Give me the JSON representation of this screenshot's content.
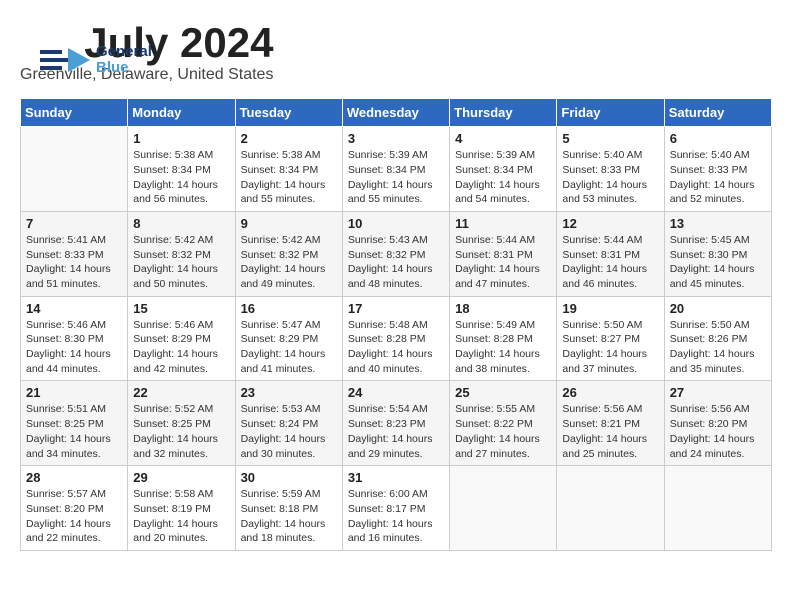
{
  "logo": {
    "part1": "General",
    "part2": "Blue"
  },
  "header": {
    "month": "July 2024",
    "location": "Greenville, Delaware, United States"
  },
  "weekdays": [
    "Sunday",
    "Monday",
    "Tuesday",
    "Wednesday",
    "Thursday",
    "Friday",
    "Saturday"
  ],
  "weeks": [
    [
      {
        "date": "",
        "info": ""
      },
      {
        "date": "1",
        "info": "Sunrise: 5:38 AM\nSunset: 8:34 PM\nDaylight: 14 hours\nand 56 minutes."
      },
      {
        "date": "2",
        "info": "Sunrise: 5:38 AM\nSunset: 8:34 PM\nDaylight: 14 hours\nand 55 minutes."
      },
      {
        "date": "3",
        "info": "Sunrise: 5:39 AM\nSunset: 8:34 PM\nDaylight: 14 hours\nand 55 minutes."
      },
      {
        "date": "4",
        "info": "Sunrise: 5:39 AM\nSunset: 8:34 PM\nDaylight: 14 hours\nand 54 minutes."
      },
      {
        "date": "5",
        "info": "Sunrise: 5:40 AM\nSunset: 8:33 PM\nDaylight: 14 hours\nand 53 minutes."
      },
      {
        "date": "6",
        "info": "Sunrise: 5:40 AM\nSunset: 8:33 PM\nDaylight: 14 hours\nand 52 minutes."
      }
    ],
    [
      {
        "date": "7",
        "info": "Sunrise: 5:41 AM\nSunset: 8:33 PM\nDaylight: 14 hours\nand 51 minutes."
      },
      {
        "date": "8",
        "info": "Sunrise: 5:42 AM\nSunset: 8:32 PM\nDaylight: 14 hours\nand 50 minutes."
      },
      {
        "date": "9",
        "info": "Sunrise: 5:42 AM\nSunset: 8:32 PM\nDaylight: 14 hours\nand 49 minutes."
      },
      {
        "date": "10",
        "info": "Sunrise: 5:43 AM\nSunset: 8:32 PM\nDaylight: 14 hours\nand 48 minutes."
      },
      {
        "date": "11",
        "info": "Sunrise: 5:44 AM\nSunset: 8:31 PM\nDaylight: 14 hours\nand 47 minutes."
      },
      {
        "date": "12",
        "info": "Sunrise: 5:44 AM\nSunset: 8:31 PM\nDaylight: 14 hours\nand 46 minutes."
      },
      {
        "date": "13",
        "info": "Sunrise: 5:45 AM\nSunset: 8:30 PM\nDaylight: 14 hours\nand 45 minutes."
      }
    ],
    [
      {
        "date": "14",
        "info": "Sunrise: 5:46 AM\nSunset: 8:30 PM\nDaylight: 14 hours\nand 44 minutes."
      },
      {
        "date": "15",
        "info": "Sunrise: 5:46 AM\nSunset: 8:29 PM\nDaylight: 14 hours\nand 42 minutes."
      },
      {
        "date": "16",
        "info": "Sunrise: 5:47 AM\nSunset: 8:29 PM\nDaylight: 14 hours\nand 41 minutes."
      },
      {
        "date": "17",
        "info": "Sunrise: 5:48 AM\nSunset: 8:28 PM\nDaylight: 14 hours\nand 40 minutes."
      },
      {
        "date": "18",
        "info": "Sunrise: 5:49 AM\nSunset: 8:28 PM\nDaylight: 14 hours\nand 38 minutes."
      },
      {
        "date": "19",
        "info": "Sunrise: 5:50 AM\nSunset: 8:27 PM\nDaylight: 14 hours\nand 37 minutes."
      },
      {
        "date": "20",
        "info": "Sunrise: 5:50 AM\nSunset: 8:26 PM\nDaylight: 14 hours\nand 35 minutes."
      }
    ],
    [
      {
        "date": "21",
        "info": "Sunrise: 5:51 AM\nSunset: 8:25 PM\nDaylight: 14 hours\nand 34 minutes."
      },
      {
        "date": "22",
        "info": "Sunrise: 5:52 AM\nSunset: 8:25 PM\nDaylight: 14 hours\nand 32 minutes."
      },
      {
        "date": "23",
        "info": "Sunrise: 5:53 AM\nSunset: 8:24 PM\nDaylight: 14 hours\nand 30 minutes."
      },
      {
        "date": "24",
        "info": "Sunrise: 5:54 AM\nSunset: 8:23 PM\nDaylight: 14 hours\nand 29 minutes."
      },
      {
        "date": "25",
        "info": "Sunrise: 5:55 AM\nSunset: 8:22 PM\nDaylight: 14 hours\nand 27 minutes."
      },
      {
        "date": "26",
        "info": "Sunrise: 5:56 AM\nSunset: 8:21 PM\nDaylight: 14 hours\nand 25 minutes."
      },
      {
        "date": "27",
        "info": "Sunrise: 5:56 AM\nSunset: 8:20 PM\nDaylight: 14 hours\nand 24 minutes."
      }
    ],
    [
      {
        "date": "28",
        "info": "Sunrise: 5:57 AM\nSunset: 8:20 PM\nDaylight: 14 hours\nand 22 minutes."
      },
      {
        "date": "29",
        "info": "Sunrise: 5:58 AM\nSunset: 8:19 PM\nDaylight: 14 hours\nand 20 minutes."
      },
      {
        "date": "30",
        "info": "Sunrise: 5:59 AM\nSunset: 8:18 PM\nDaylight: 14 hours\nand 18 minutes."
      },
      {
        "date": "31",
        "info": "Sunrise: 6:00 AM\nSunset: 8:17 PM\nDaylight: 14 hours\nand 16 minutes."
      },
      {
        "date": "",
        "info": ""
      },
      {
        "date": "",
        "info": ""
      },
      {
        "date": "",
        "info": ""
      }
    ]
  ]
}
